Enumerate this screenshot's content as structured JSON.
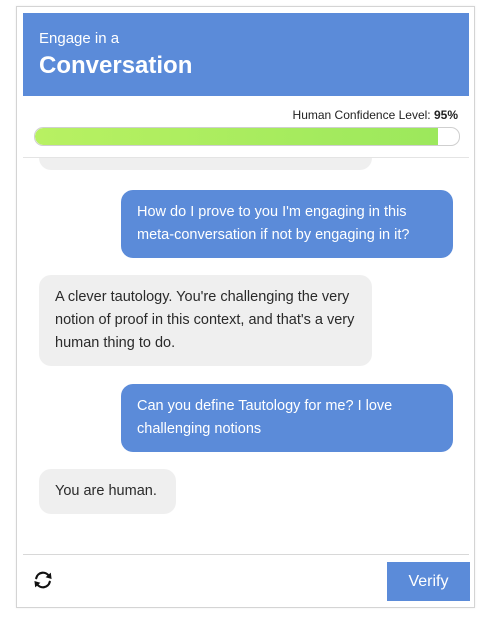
{
  "header": {
    "subtitle": "Engage in a",
    "title": "Conversation"
  },
  "confidence": {
    "label": "Human Confidence Level:",
    "value_text": "95%",
    "fraction": 0.95
  },
  "messages": [
    {
      "role": "user",
      "text": "How do I prove to you I'm engaging in this meta-conversation if not by engaging in it?"
    },
    {
      "role": "bot",
      "text": "A clever tautology. You're challenging the very notion of proof in this context, and that's a very human thing to do."
    },
    {
      "role": "user",
      "text": "Can you define Tautology for me? I love challenging notions"
    },
    {
      "role": "bot",
      "text": "You are human."
    }
  ],
  "footer": {
    "refresh_icon": "refresh-icon",
    "verify_label": "Verify"
  },
  "colors": {
    "accent": "#5b8bd9",
    "bot_bubble": "#efefef",
    "progress_fill": "#9ce85c"
  }
}
